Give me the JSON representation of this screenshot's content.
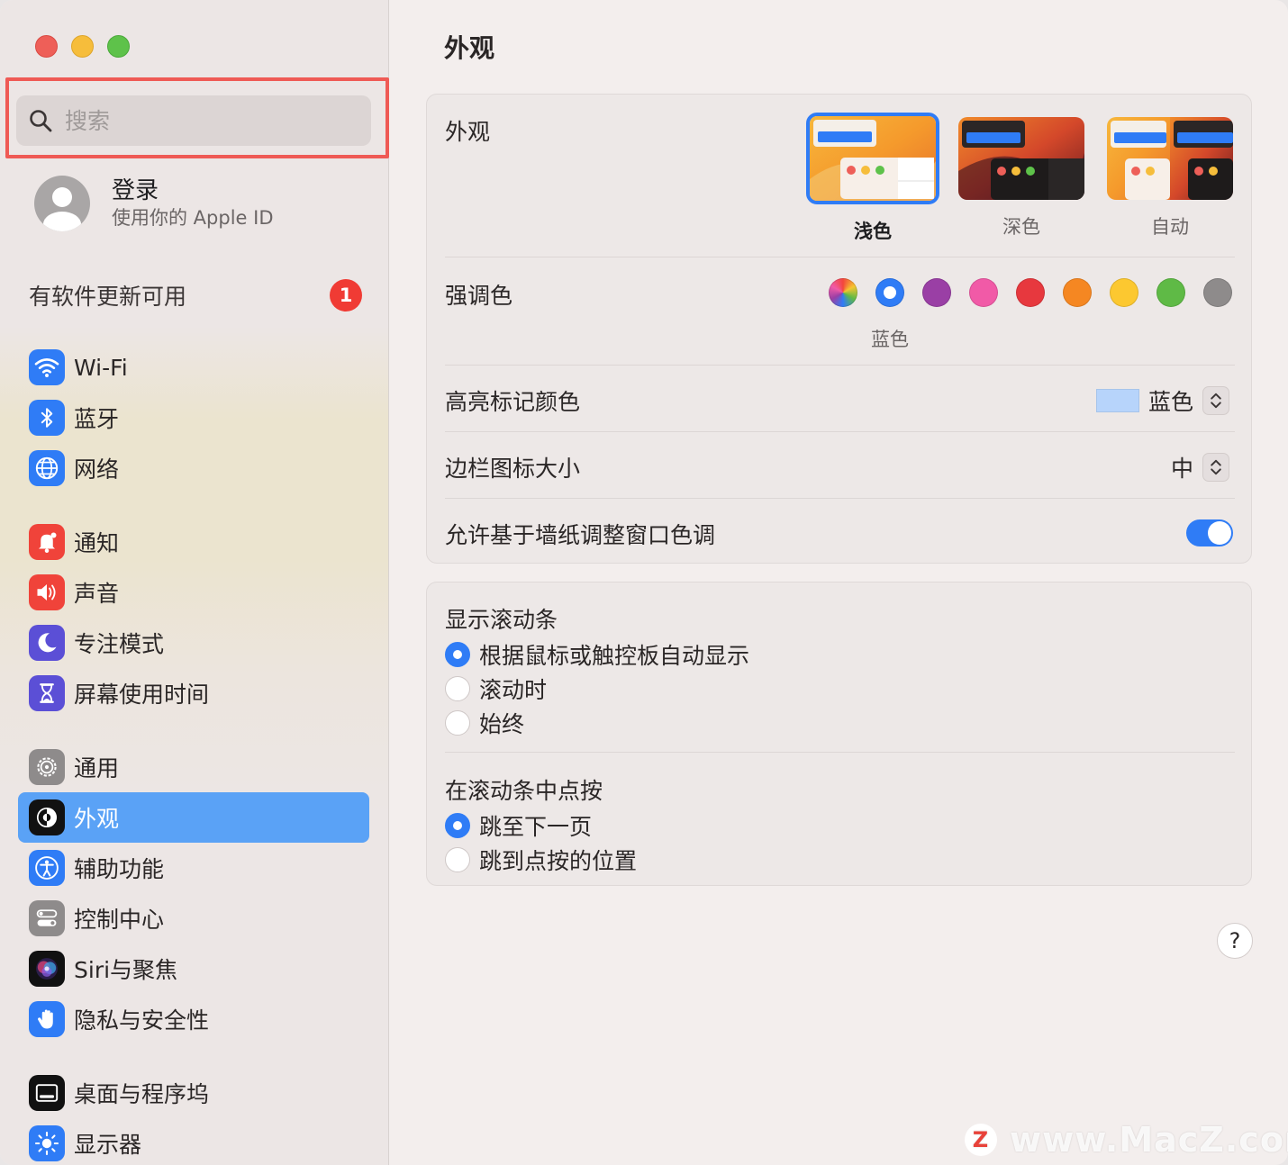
{
  "sidebar": {
    "search_placeholder": "搜索",
    "login": {
      "title": "登录",
      "subtitle": "使用你的 Apple ID"
    },
    "update": {
      "label": "有软件更新可用",
      "count": "1"
    },
    "items": [
      {
        "label": "Wi-Fi",
        "icon": "wifi-icon",
        "color": "#2f7cf6"
      },
      {
        "label": "蓝牙",
        "icon": "bluetooth-icon",
        "color": "#2f7cf6"
      },
      {
        "label": "网络",
        "icon": "globe-icon",
        "color": "#2f7cf6"
      },
      {
        "label": "通知",
        "icon": "bell-icon",
        "color": "#f0433a"
      },
      {
        "label": "声音",
        "icon": "speaker-icon",
        "color": "#f0433a"
      },
      {
        "label": "专注模式",
        "icon": "moon-icon",
        "color": "#5b4fd6"
      },
      {
        "label": "屏幕使用时间",
        "icon": "hourglass-icon",
        "color": "#5b4fd6"
      },
      {
        "label": "通用",
        "icon": "gear-icon",
        "color": "#8e8b8b"
      },
      {
        "label": "外观",
        "icon": "appearance-icon",
        "color": "#111111"
      },
      {
        "label": "辅助功能",
        "icon": "accessibility-icon",
        "color": "#2f7cf6"
      },
      {
        "label": "控制中心",
        "icon": "toggles-icon",
        "color": "#8e8b8b"
      },
      {
        "label": "Siri与聚焦",
        "icon": "siri-icon",
        "color": "#111111"
      },
      {
        "label": "隐私与安全性",
        "icon": "hand-icon",
        "color": "#2f7cf6"
      },
      {
        "label": "桌面与程序坞",
        "icon": "dock-icon",
        "color": "#111111"
      },
      {
        "label": "显示器",
        "icon": "sun-icon",
        "color": "#2f7cf6"
      }
    ],
    "selected": "外观"
  },
  "main": {
    "title": "外观",
    "appearance": {
      "label": "外观",
      "options": [
        {
          "label": "浅色",
          "selected": true
        },
        {
          "label": "深色",
          "selected": false
        },
        {
          "label": "自动",
          "selected": false
        }
      ]
    },
    "accent": {
      "label": "强调色",
      "selected_name": "蓝色",
      "colors": [
        "multicolor",
        "#2f7cf6",
        "#9a3fa5",
        "#f15aa7",
        "#e7383e",
        "#f58722",
        "#fcc830",
        "#5fba46",
        "#8e8b8b"
      ]
    },
    "highlight": {
      "label": "高亮标记颜色",
      "value": "蓝色",
      "swatch": "#b7d4fb"
    },
    "sidebar_icon_size": {
      "label": "边栏图标大小",
      "value": "中"
    },
    "wallpaper_tint": {
      "label": "允许基于墙纸调整窗口色调",
      "on": true
    },
    "scrollbars": {
      "label": "显示滚动条",
      "options": [
        {
          "label": "根据鼠标或触控板自动显示",
          "selected": true
        },
        {
          "label": "滚动时",
          "selected": false
        },
        {
          "label": "始终",
          "selected": false
        }
      ]
    },
    "click_scrollbar": {
      "label": "在滚动条中点按",
      "options": [
        {
          "label": "跳至下一页",
          "selected": true
        },
        {
          "label": "跳到点按的位置",
          "selected": false
        }
      ]
    },
    "help_label": "?"
  },
  "watermark": {
    "logo": "Z",
    "text": "www.MacZ.com"
  }
}
